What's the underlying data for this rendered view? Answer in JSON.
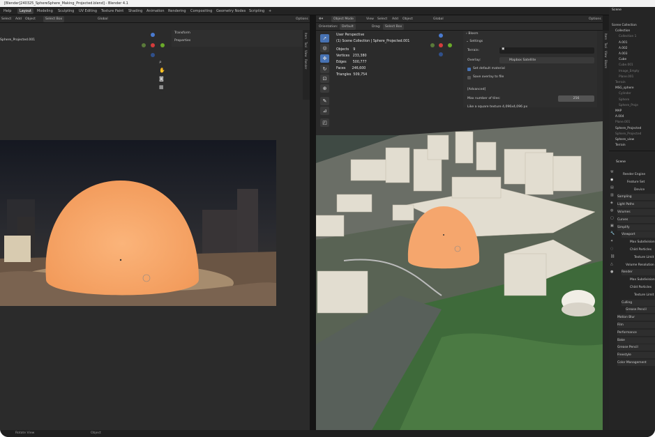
{
  "title": "[Blender]240325_SphereSphere_Making_Projected.blend] - Blender 4.1",
  "workspace_tabs": [
    {
      "label": "Help",
      "active": false
    },
    {
      "label": "Layout",
      "active": true
    },
    {
      "label": "Modeling",
      "active": false
    },
    {
      "label": "Sculpting",
      "active": false
    },
    {
      "label": "UV Editing",
      "active": false
    },
    {
      "label": "Texture Paint",
      "active": false
    },
    {
      "label": "Shading",
      "active": false
    },
    {
      "label": "Animation",
      "active": false
    },
    {
      "label": "Rendering",
      "active": false
    },
    {
      "label": "Compositing",
      "active": false
    },
    {
      "label": "Geometry Nodes",
      "active": false
    },
    {
      "label": "Scripting",
      "active": false
    },
    {
      "label": "+",
      "active": false
    }
  ],
  "left_viewport": {
    "header": [
      "Select",
      "Add",
      "Object",
      "Select Box",
      "Global",
      "Options"
    ],
    "label": "Sphere_Projected.001",
    "panels": [
      "Transform",
      "Properties"
    ],
    "sidetabs": [
      "Item",
      "Tool",
      "View",
      "Render"
    ]
  },
  "right_viewport": {
    "header": [
      "Object Mode",
      "View",
      "Select",
      "Add",
      "Object",
      "Global",
      "Options"
    ],
    "subheader": [
      "Orientation:",
      "Default",
      "Drag:",
      "Select Box"
    ],
    "info": {
      "perspective": "User Perspective",
      "collection": "(1) Scene Collection | Sphere_Projected.001",
      "objects": "Objects    9",
      "vertices": "Vertices   233,380",
      "edges": "Edges      500,777",
      "faces": "Faces      246,600",
      "triangles": "Triangles  509,754"
    },
    "sidetabs": [
      "Item",
      "Tool",
      "View",
      "Blosm"
    ],
    "blosm": {
      "title": "Blosm",
      "settings": "Settings",
      "terrain_label": "Terrain:",
      "overlay_label": "Overlay:",
      "overlay_value": "Mapbox Satellite",
      "set_default_material": "Set default material",
      "save_overlay": "Save overlay to file",
      "advanced": "[Advanced]",
      "max_tiles_label": "Max number of tiles:",
      "max_tiles_value": "256",
      "hint": "Like a square texture 4,096x4,096 px"
    }
  },
  "outliner": {
    "title": "Scene",
    "rows": [
      {
        "label": "Scene Collection",
        "level": 0,
        "dim": false
      },
      {
        "label": "Collection",
        "level": 1,
        "dim": false
      },
      {
        "label": "Collection 1",
        "level": 2,
        "dim": true
      },
      {
        "label": "A.001",
        "level": 2,
        "dim": false
      },
      {
        "label": "A.002",
        "level": 2,
        "dim": false
      },
      {
        "label": "A.003",
        "level": 2,
        "dim": false
      },
      {
        "label": "Cube",
        "level": 2,
        "dim": false
      },
      {
        "label": "Cube.001",
        "level": 2,
        "dim": true
      },
      {
        "label": "Image_Empty",
        "level": 2,
        "dim": true
      },
      {
        "label": "Plane.001",
        "level": 2,
        "dim": true
      },
      {
        "label": "Terrain",
        "level": 1,
        "dim": true
      },
      {
        "label": "MSG_sphere",
        "level": 1,
        "dim": false
      },
      {
        "label": "Cylinder",
        "level": 2,
        "dim": true
      },
      {
        "label": "Sphere",
        "level": 2,
        "dim": true
      },
      {
        "label": "Sphere_Proje",
        "level": 2,
        "dim": true
      },
      {
        "label": "MAP",
        "level": 1,
        "dim": false
      },
      {
        "label": "A.004",
        "level": 1,
        "dim": false
      },
      {
        "label": "Plane.001",
        "level": 1,
        "dim": true
      },
      {
        "label": "Sphere_Projected",
        "level": 1,
        "dim": false
      },
      {
        "label": "Sphere_Projected",
        "level": 1,
        "dim": true
      },
      {
        "label": "Sphere_view",
        "level": 1,
        "dim": false
      },
      {
        "label": "Terrain",
        "level": 1,
        "dim": false
      }
    ]
  },
  "properties": {
    "scene": "Scene",
    "rows": [
      {
        "label": "Render Engine",
        "indent": 20,
        "kind": "text"
      },
      {
        "label": "Feature Set",
        "indent": 26,
        "kind": "text"
      },
      {
        "label": "Device",
        "indent": 36,
        "kind": "text"
      },
      {
        "label": "Sampling",
        "indent": 12,
        "kind": "section"
      },
      {
        "label": "Light Paths",
        "indent": 12,
        "kind": "section"
      },
      {
        "label": "Volumes",
        "indent": 12,
        "kind": "section"
      },
      {
        "label": "Curves",
        "indent": 12,
        "kind": "section"
      },
      {
        "label": "Simplify",
        "indent": 12,
        "kind": "section"
      },
      {
        "label": "Viewport",
        "indent": 18,
        "kind": "section"
      },
      {
        "label": "Max Subdivision",
        "indent": 30,
        "kind": "text"
      },
      {
        "label": "Child Particles",
        "indent": 30,
        "kind": "text"
      },
      {
        "label": "Texture Limit",
        "indent": 36,
        "kind": "text"
      },
      {
        "label": "Volume Resolution",
        "indent": 24,
        "kind": "text"
      },
      {
        "label": "Render",
        "indent": 18,
        "kind": "section"
      },
      {
        "label": "Max Subdivision",
        "indent": 30,
        "kind": "text"
      },
      {
        "label": "Child Particles",
        "indent": 30,
        "kind": "text"
      },
      {
        "label": "Texture Limit",
        "indent": 36,
        "kind": "text"
      },
      {
        "label": "Culling",
        "indent": 18,
        "kind": "section"
      },
      {
        "label": "Grease Pencil",
        "indent": 24,
        "kind": "section"
      },
      {
        "label": "Motion Blur",
        "indent": 12,
        "kind": "section"
      },
      {
        "label": "Film",
        "indent": 12,
        "kind": "section"
      },
      {
        "label": "Performance",
        "indent": 12,
        "kind": "section"
      },
      {
        "label": "Bake",
        "indent": 12,
        "kind": "section"
      },
      {
        "label": "Grease Pencil",
        "indent": 12,
        "kind": "section"
      },
      {
        "label": "Freestyle",
        "indent": 12,
        "kind": "section"
      },
      {
        "label": "Color Management",
        "indent": 12,
        "kind": "section"
      }
    ]
  },
  "status": {
    "left": "Rotate View",
    "right": "Object"
  },
  "colors": {
    "accent": "#4772b3",
    "sphere": "#f5a66d"
  }
}
